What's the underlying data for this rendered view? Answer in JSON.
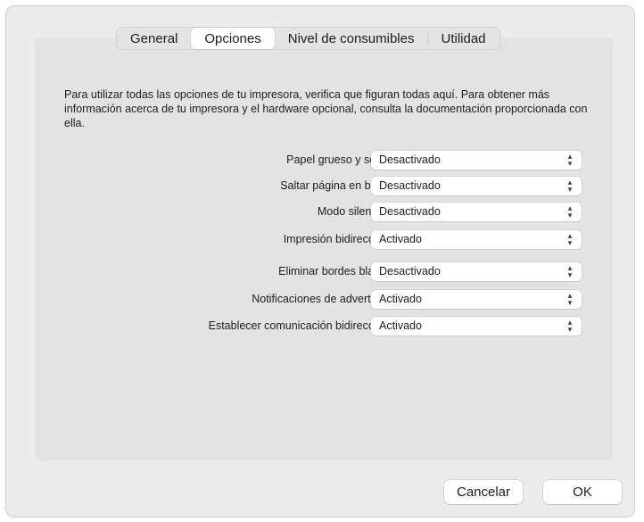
{
  "tabs": [
    {
      "label": "General",
      "active": false
    },
    {
      "label": "Opciones",
      "active": true
    },
    {
      "label": "Nivel de consumibles",
      "active": false
    },
    {
      "label": "Utilidad",
      "active": false
    }
  ],
  "description": "Para utilizar todas las opciones de tu impresora, verifica que figuran todas aquí. Para obtener más información acerca de tu impresora y el hardware opcional, consulta la documentación proporcionada con ella.",
  "options": [
    {
      "label": "Papel grueso y sobres:",
      "value": "Desactivado"
    },
    {
      "label": "Saltar página en blanco:",
      "value": "Desactivado"
    },
    {
      "label": "Modo silencioso:",
      "value": "Desactivado"
    },
    {
      "label": "Impresión bidireccional:",
      "value": "Activado"
    },
    {
      "label": "Eliminar bordes blancos:",
      "value": "Desactivado"
    },
    {
      "label": "Notificaciones de advertencia:",
      "value": "Activado"
    },
    {
      "label": "Establecer comunicación bidireccional:",
      "value": "Activado"
    }
  ],
  "buttons": {
    "cancel": "Cancelar",
    "ok": "OK"
  }
}
